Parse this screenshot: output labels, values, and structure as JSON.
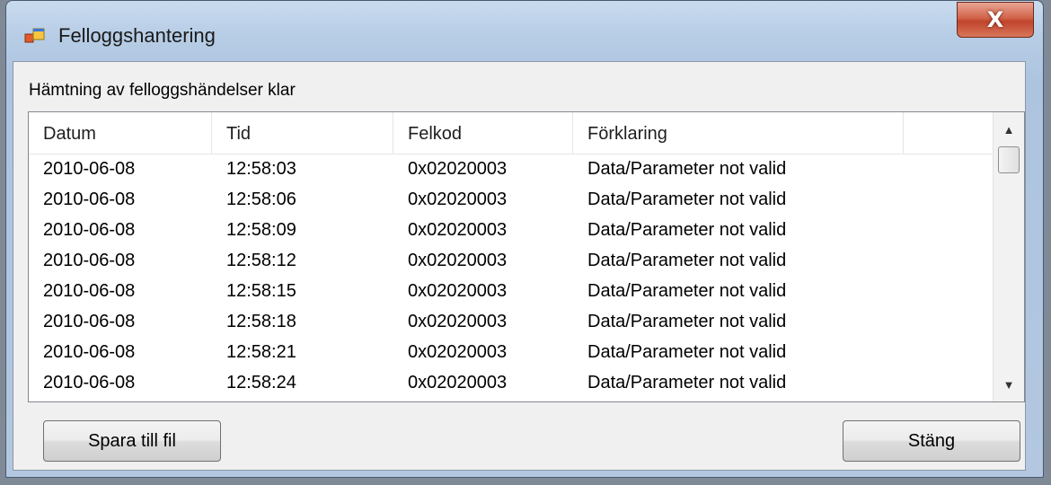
{
  "window": {
    "title": "Felloggshantering",
    "close_label": "X"
  },
  "status_text": "Hämtning av felloggshändelser klar",
  "list": {
    "columns": [
      "Datum",
      "Tid",
      "Felkod",
      "Förklaring"
    ],
    "rows": [
      [
        "2010-06-08",
        "12:58:03",
        "0x02020003",
        "Data/Parameter not valid"
      ],
      [
        "2010-06-08",
        "12:58:06",
        "0x02020003",
        "Data/Parameter not valid"
      ],
      [
        "2010-06-08",
        "12:58:09",
        "0x02020003",
        "Data/Parameter not valid"
      ],
      [
        "2010-06-08",
        "12:58:12",
        "0x02020003",
        "Data/Parameter not valid"
      ],
      [
        "2010-06-08",
        "12:58:15",
        "0x02020003",
        "Data/Parameter not valid"
      ],
      [
        "2010-06-08",
        "12:58:18",
        "0x02020003",
        "Data/Parameter not valid"
      ],
      [
        "2010-06-08",
        "12:58:21",
        "0x02020003",
        "Data/Parameter not valid"
      ],
      [
        "2010-06-08",
        "12:58:24",
        "0x02020003",
        "Data/Parameter not valid"
      ]
    ]
  },
  "buttons": {
    "save": "Spara till fil",
    "close": "Stäng"
  },
  "icons": {
    "app": "app-window-icon",
    "scroll_up": "scroll-up-arrow-icon",
    "scroll_down": "scroll-down-arrow-icon"
  }
}
